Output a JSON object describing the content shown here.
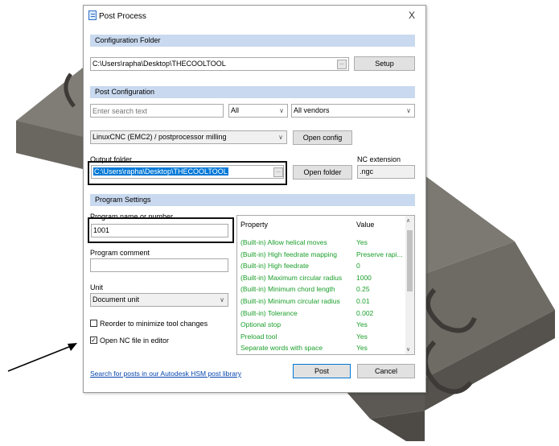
{
  "dialog": {
    "title": "Post Process",
    "close_glyph": "X",
    "app_icon": "post-process-icon"
  },
  "config_folder": {
    "header": "Configuration Folder",
    "path": "C:\\Users\\rapha\\Desktop\\THECOOLTOOL",
    "browse_label": "...",
    "setup_label": "Setup"
  },
  "post_config": {
    "header": "Post Configuration",
    "search_placeholder": "Enter search text",
    "filter_value": "All",
    "vendor_value": "All vendors",
    "post_value": "LinuxCNC (EMC2) / postprocessor milling",
    "open_config_label": "Open config",
    "output_folder_label": "Output folder",
    "output_folder_value": "C:\\Users\\rapha\\Desktop\\THECOOLTOOL",
    "open_folder_label": "Open folder",
    "nc_extension_label": "NC extension",
    "nc_extension_value": ".ngc"
  },
  "program_settings": {
    "header": "Program Settings",
    "program_name_label": "Program name or number",
    "program_name_value": "1001",
    "program_comment_label": "Program comment",
    "program_comment_value": "",
    "unit_label": "Unit",
    "unit_value": "Document unit",
    "reorder_label": "Reorder to minimize tool changes",
    "reorder_checked": false,
    "open_nc_label": "Open NC file in editor",
    "open_nc_checked": true
  },
  "properties": {
    "col_property": "Property",
    "col_value": "Value",
    "rows": [
      {
        "property": "(Built-in) Allow helical moves",
        "value": "Yes"
      },
      {
        "property": "(Built-in) High feedrate mapping",
        "value": "Preserve rapi..."
      },
      {
        "property": "(Built-in) High feedrate",
        "value": "0"
      },
      {
        "property": "(Built-in) Maximum circular radius",
        "value": "1000"
      },
      {
        "property": "(Built-in) Minimum chord length",
        "value": "0.25"
      },
      {
        "property": "(Built-in) Minimum circular radius",
        "value": "0.01"
      },
      {
        "property": "(Built-in) Tolerance",
        "value": "0.002"
      },
      {
        "property": "Optional stop",
        "value": "Yes"
      },
      {
        "property": "Preload tool",
        "value": "Yes"
      },
      {
        "property": "Separate words with space",
        "value": "Yes"
      }
    ]
  },
  "footer": {
    "search_link": "Search for posts in our Autodesk HSM post library",
    "post_label": "Post",
    "cancel_label": "Cancel"
  },
  "colors": {
    "section_header": "#c9d9ef",
    "property_text": "#1a9e2a",
    "selection": "#0078d7",
    "background_part": "#6f6c66"
  }
}
